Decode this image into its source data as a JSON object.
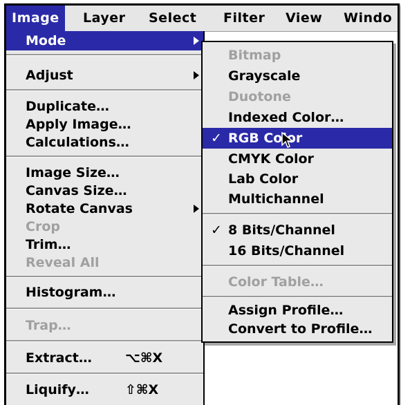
{
  "menubar": {
    "items": [
      "Image",
      "Layer",
      "Select",
      "Filter",
      "View",
      "Windo"
    ],
    "active_index": 0
  },
  "image_menu": {
    "items": [
      {
        "label": "Mode",
        "submenu": true,
        "highlighted": true
      },
      {
        "label": "Adjust",
        "submenu": true
      },
      {
        "label": "Duplicate…"
      },
      {
        "label": "Apply Image…"
      },
      {
        "label": "Calculations…"
      },
      {
        "label": "Image Size…"
      },
      {
        "label": "Canvas Size…"
      },
      {
        "label": "Rotate Canvas",
        "submenu": true
      },
      {
        "label": "Crop",
        "disabled": true
      },
      {
        "label": "Trim…"
      },
      {
        "label": "Reveal All",
        "disabled": true
      },
      {
        "label": "Histogram…"
      },
      {
        "label": "Trap…",
        "disabled": true
      },
      {
        "label": "Extract…",
        "shortcut": "⌥⌘X"
      },
      {
        "label": "Liquify…",
        "shortcut": "⇧⌘X"
      }
    ]
  },
  "mode_submenu": {
    "items": [
      {
        "label": "Bitmap",
        "disabled": true
      },
      {
        "label": "Grayscale"
      },
      {
        "label": "Duotone",
        "disabled": true
      },
      {
        "label": "Indexed Color…"
      },
      {
        "label": "RGB Color",
        "checked": true,
        "highlighted": true
      },
      {
        "label": "CMYK Color"
      },
      {
        "label": "Lab Color"
      },
      {
        "label": "Multichannel"
      },
      {
        "label": "8 Bits/Channel",
        "checked": true
      },
      {
        "label": "16 Bits/Channel"
      },
      {
        "label": "Color Table…",
        "disabled": true
      },
      {
        "label": "Assign Profile…"
      },
      {
        "label": "Convert to Profile…"
      }
    ],
    "check_glyph": "✓"
  },
  "colors": {
    "highlight": "#2a2aa8",
    "menu_bg": "#e9e9e9",
    "disabled": "#a0a0a0"
  }
}
